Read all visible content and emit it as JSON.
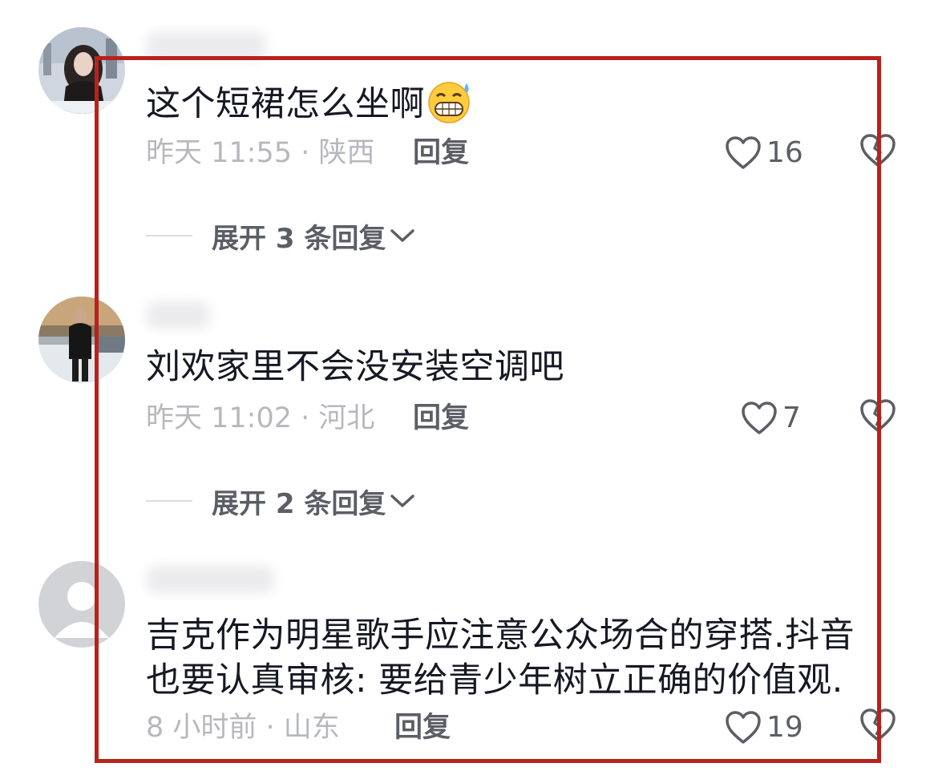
{
  "comments": [
    {
      "text": "这个短裙怎么坐啊",
      "emoji": "sweat-grin-emoji",
      "meta": "昨天 11:55 · 陕西",
      "reply_label": "回复",
      "likes": "16",
      "expand_label": "展开 3 条回复"
    },
    {
      "text": "刘欢家里不会没安装空调吧",
      "meta": "昨天 11:02 · 河北",
      "reply_label": "回复",
      "likes": "7",
      "expand_label": "展开 2 条回复"
    },
    {
      "text_lines": [
        "吉克作为明星歌手应注意公众场合的穿搭.抖音",
        "也要认真审核: 要给青少年树立正确的价值观."
      ],
      "meta": "8 小时前 · 山东",
      "reply_label": "回复",
      "likes": "19"
    }
  ],
  "icons": {
    "like": "heart-outline-icon",
    "dislike": "broken-heart-outline-icon",
    "expand": "chevron-down-icon"
  },
  "colors": {
    "highlight_border": "#b8221c",
    "primary_text": "#161823",
    "secondary_text": "#b7b8bd",
    "action_text": "#5c5e66"
  }
}
